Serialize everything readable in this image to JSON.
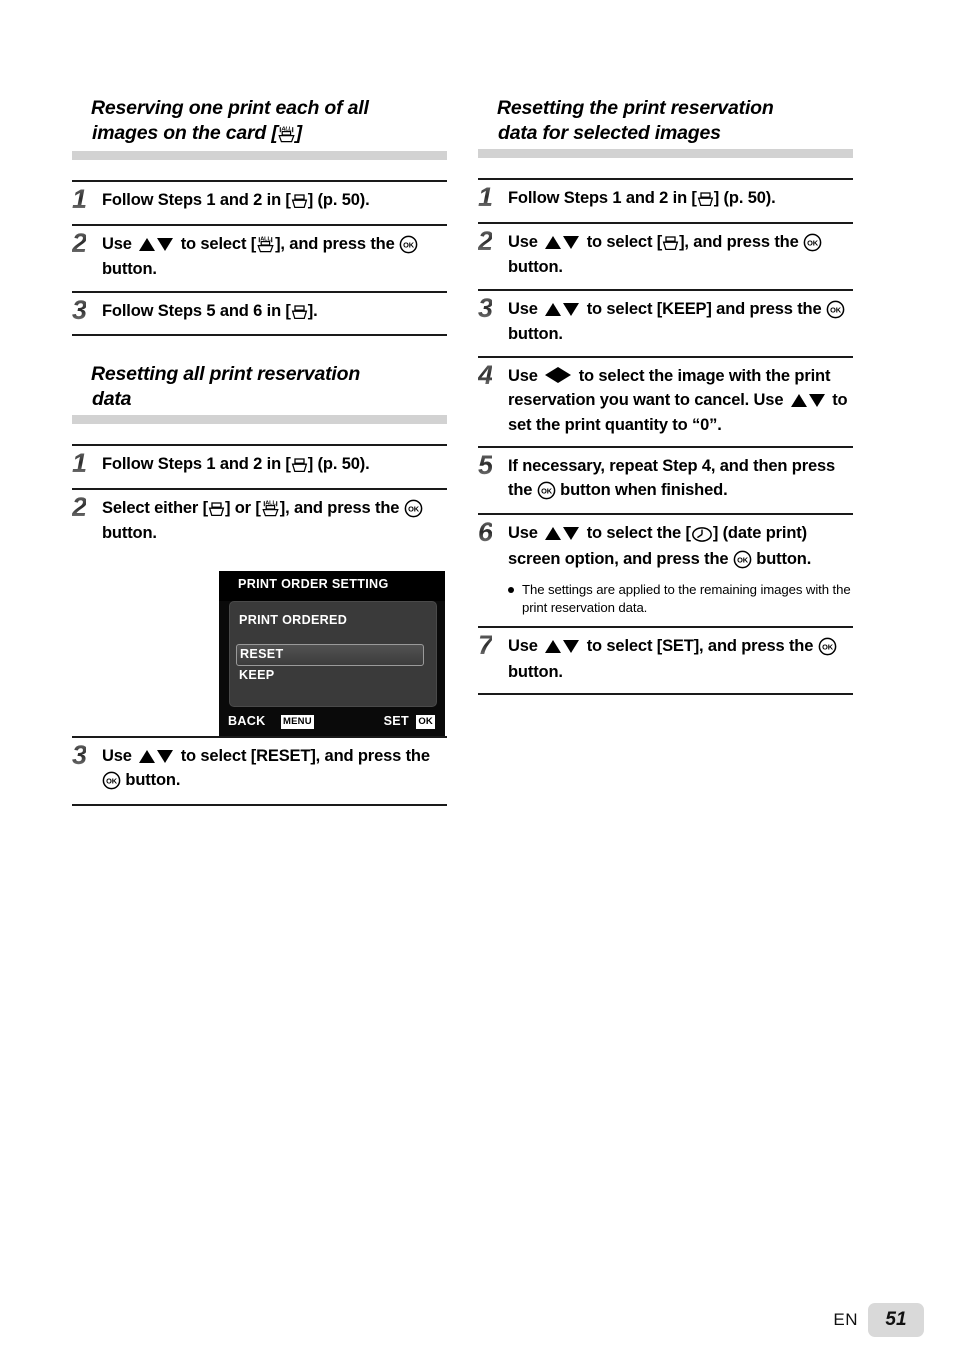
{
  "page": {
    "language_code": "EN",
    "page_number": "51",
    "accent_bar_color": "#d2d2d2"
  },
  "icons": {
    "print": "print-icon",
    "print_all": "print-all-icon",
    "ok_button": "ok-button-icon",
    "up_down": "up-down-arrows-icon",
    "left_right": "left-right-arrows-icon",
    "date_print": "date-print-clock-icon"
  },
  "left_column": {
    "sections": [
      {
        "title_line1": "Reserving one print each of all",
        "title_line2_prefix": "images on the card [",
        "title_line2_suffix": "]",
        "steps": [
          {
            "number": "1",
            "parts": [
              {
                "t": "text",
                "v": "Follow Steps 1 and 2 in ["
              },
              {
                "t": "icon",
                "v": "print-icon"
              },
              {
                "t": "text",
                "v": "] (p. 50)."
              }
            ]
          },
          {
            "number": "2",
            "parts": [
              {
                "t": "text",
                "v": "Use "
              },
              {
                "t": "icon",
                "v": "up-down-arrows-icon"
              },
              {
                "t": "text",
                "v": " to select ["
              },
              {
                "t": "icon",
                "v": "print-all-icon"
              },
              {
                "t": "text",
                "v": "], and press the "
              },
              {
                "t": "icon",
                "v": "ok-button-icon"
              },
              {
                "t": "text",
                "v": " button."
              }
            ]
          },
          {
            "number": "3",
            "parts": [
              {
                "t": "text",
                "v": "Follow Steps 5 and 6 in ["
              },
              {
                "t": "icon",
                "v": "print-icon"
              },
              {
                "t": "text",
                "v": "]."
              }
            ]
          }
        ]
      },
      {
        "title_line1": "Resetting all print reservation",
        "title_line2_prefix": "data",
        "title_line2_suffix": "",
        "steps": [
          {
            "number": "1",
            "parts": [
              {
                "t": "text",
                "v": "Follow Steps 1 and 2 in ["
              },
              {
                "t": "icon",
                "v": "print-icon"
              },
              {
                "t": "text",
                "v": "] (p. 50)."
              }
            ]
          },
          {
            "number": "2",
            "parts": [
              {
                "t": "text",
                "v": "Select either ["
              },
              {
                "t": "icon",
                "v": "print-icon"
              },
              {
                "t": "text",
                "v": "] or ["
              },
              {
                "t": "icon",
                "v": "print-all-icon"
              },
              {
                "t": "text",
                "v": "], and press the "
              },
              {
                "t": "icon",
                "v": "ok-button-icon"
              },
              {
                "t": "text",
                "v": " button."
              }
            ]
          },
          {
            "number": "3",
            "parts": [
              {
                "t": "text",
                "v": "Use "
              },
              {
                "t": "icon",
                "v": "up-down-arrows-icon"
              },
              {
                "t": "text",
                "v": " to select [RESET], and press the "
              },
              {
                "t": "icon",
                "v": "ok-button-icon"
              },
              {
                "t": "text",
                "v": " button."
              }
            ]
          }
        ]
      }
    ],
    "camera_screen": {
      "title": "PRINT ORDER SETTING",
      "subtitle": "PRINT ORDERED",
      "options": [
        "RESET",
        "KEEP"
      ],
      "selected_option": "RESET",
      "footer_left_label": "BACK",
      "footer_left_badge": "MENU",
      "footer_right_label": "SET",
      "footer_right_badge": "OK"
    }
  },
  "right_column": {
    "sections": [
      {
        "title_line1": "Resetting the print reservation",
        "title_line2_prefix": "data for selected images",
        "title_line2_suffix": "",
        "steps": [
          {
            "number": "1",
            "parts": [
              {
                "t": "text",
                "v": "Follow Steps 1 and 2 in ["
              },
              {
                "t": "icon",
                "v": "print-icon"
              },
              {
                "t": "text",
                "v": "] (p. 50)."
              }
            ]
          },
          {
            "number": "2",
            "parts": [
              {
                "t": "text",
                "v": "Use "
              },
              {
                "t": "icon",
                "v": "up-down-arrows-icon"
              },
              {
                "t": "text",
                "v": " to select ["
              },
              {
                "t": "icon",
                "v": "print-icon"
              },
              {
                "t": "text",
                "v": "], and press the "
              },
              {
                "t": "icon",
                "v": "ok-button-icon"
              },
              {
                "t": "text",
                "v": " button."
              }
            ]
          },
          {
            "number": "3",
            "parts": [
              {
                "t": "text",
                "v": "Use "
              },
              {
                "t": "icon",
                "v": "up-down-arrows-icon"
              },
              {
                "t": "text",
                "v": " to select [KEEP] and press the "
              },
              {
                "t": "icon",
                "v": "ok-button-icon"
              },
              {
                "t": "text",
                "v": " button."
              }
            ]
          },
          {
            "number": "4",
            "parts": [
              {
                "t": "text",
                "v": "Use "
              },
              {
                "t": "icon",
                "v": "left-right-arrows-icon"
              },
              {
                "t": "text",
                "v": " to select the image with the print reservation you want to cancel. Use "
              },
              {
                "t": "icon",
                "v": "up-down-arrows-icon"
              },
              {
                "t": "text",
                "v": " to set the print quantity to “0”."
              }
            ]
          },
          {
            "number": "5",
            "parts": [
              {
                "t": "text",
                "v": "If necessary, repeat Step 4, and then press the "
              },
              {
                "t": "icon",
                "v": "ok-button-icon"
              },
              {
                "t": "text",
                "v": " button when finished."
              }
            ]
          },
          {
            "number": "6",
            "parts": [
              {
                "t": "text",
                "v": "Use "
              },
              {
                "t": "icon",
                "v": "up-down-arrows-icon"
              },
              {
                "t": "text",
                "v": " to select the ["
              },
              {
                "t": "icon",
                "v": "date-print-clock-icon"
              },
              {
                "t": "text",
                "v": "] (date print) screen option, and press the "
              },
              {
                "t": "icon",
                "v": "ok-button-icon"
              },
              {
                "t": "text",
                "v": " button."
              }
            ],
            "note": "The settings are applied to the remaining images with the print reservation data."
          },
          {
            "number": "7",
            "parts": [
              {
                "t": "text",
                "v": "Use "
              },
              {
                "t": "icon",
                "v": "up-down-arrows-icon"
              },
              {
                "t": "text",
                "v": " to select [SET], and press the "
              },
              {
                "t": "icon",
                "v": "ok-button-icon"
              },
              {
                "t": "text",
                "v": " button."
              }
            ]
          }
        ]
      }
    ]
  }
}
